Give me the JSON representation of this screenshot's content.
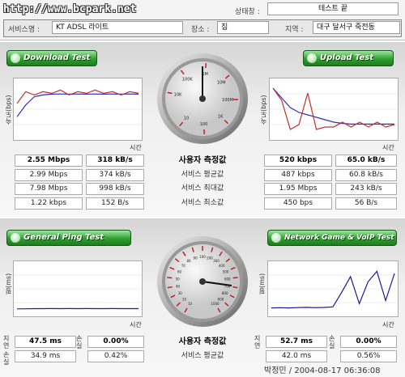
{
  "header": {
    "site_url": "http://www.bcpark.net",
    "status_label": "상태창 :",
    "status_value": "테스트 끝",
    "service_label": "서비스명 :",
    "service_value": "KT ADSL 라이트",
    "place_label": "장소 :",
    "place_value": "집",
    "region_label": "지역 :",
    "region_value": "대구 달서구 죽전동"
  },
  "speed": {
    "download_button": "Download Test",
    "upload_button": "Upload Test",
    "axis_label": "시간",
    "speed_axis_label": "속도(bps)",
    "row_labels": [
      "사용자 측정값",
      "서비스 평균값",
      "서비스 최대값",
      "서비스 최소값"
    ],
    "download_rows": [
      [
        "2.55 Mbps",
        "318 kB/s"
      ],
      [
        "2.99 Mbps",
        "374 kB/s"
      ],
      [
        "7.98 Mbps",
        "998 kB/s"
      ],
      [
        "1.22 kbps",
        "152 B/s"
      ]
    ],
    "upload_rows": [
      [
        "520 kbps",
        "65.0 kB/s"
      ],
      [
        "487 kbps",
        "60.8 kB/s"
      ],
      [
        "1.95 Mbps",
        "243 kB/s"
      ],
      [
        "450 bps",
        "56 B/s"
      ]
    ],
    "gauge_labels": [
      "10K",
      "100K",
      "1M",
      "10M",
      "100M",
      "1K",
      "100",
      "10"
    ]
  },
  "ping": {
    "ping_button": "General Ping Test",
    "game_button": "Network Game & VoIP Test",
    "axis_label": "시간",
    "ping_axis_label": "핑(ms)",
    "row_labels": [
      "사용자 측정값",
      "서비스 평균값"
    ],
    "left_col_labels": [
      "지연",
      "손실"
    ],
    "ping_rows": [
      [
        "47.5 ms",
        "0.00%"
      ],
      [
        "34.9 ms",
        "0.42%"
      ]
    ],
    "game_rows": [
      [
        "52.7 ms",
        "0.00%"
      ],
      [
        "42.0 ms",
        "0.56%"
      ]
    ],
    "gauge_labels": [
      "10",
      "20",
      "30",
      "40",
      "50",
      "60",
      "70",
      "80",
      "90",
      "100",
      "200",
      "300",
      "400",
      "500",
      "600",
      "700",
      "800",
      "900",
      "1000"
    ]
  },
  "footer": {
    "signature": "박정민 / 2004-08-17 06:36:08"
  },
  "chart_data": [
    {
      "type": "line",
      "title": "",
      "xlabel": "시간",
      "ylabel": "속도(bps)",
      "series": [
        {
          "values": [
            1.2,
            1.9,
            2.4,
            2.5,
            2.55,
            2.56,
            2.55,
            2.56,
            2.55,
            2.56,
            2.55,
            2.56,
            2.55,
            2.56,
            2.55
          ]
        },
        {
          "values": [
            2.0,
            2.7,
            2.5,
            2.7,
            2.6,
            2.8,
            2.5,
            2.7,
            2.6,
            2.8,
            2.6,
            2.7,
            2.5,
            2.7,
            2.6
          ]
        }
      ]
    },
    {
      "type": "line",
      "title": "",
      "xlabel": "시간",
      "ylabel": "속도(bps)",
      "series": [
        {
          "values": [
            2.0,
            1.6,
            1.2,
            1.0,
            0.9,
            0.8,
            0.7,
            0.6,
            0.55,
            0.52,
            0.52,
            0.52,
            0.52,
            0.52,
            0.52
          ]
        },
        {
          "values": [
            2.0,
            1.5,
            0.3,
            0.5,
            1.8,
            0.3,
            0.4,
            0.4,
            0.6,
            0.4,
            0.6,
            0.4,
            0.6,
            0.4,
            0.5
          ]
        }
      ]
    },
    {
      "type": "line",
      "title": "",
      "xlabel": "시간",
      "ylabel": "핑(ms)",
      "series": [
        {
          "values": [
            45,
            46,
            47,
            47,
            48,
            47,
            48,
            47,
            48,
            47,
            47,
            48,
            47,
            47,
            47
          ]
        }
      ]
    },
    {
      "type": "line",
      "title": "",
      "xlabel": "시간",
      "ylabel": "핑(ms)",
      "series": [
        {
          "values": [
            50,
            52,
            50,
            53,
            55,
            52,
            54,
            60,
            200,
            350,
            90,
            300,
            400,
            120,
            380
          ]
        }
      ]
    }
  ]
}
